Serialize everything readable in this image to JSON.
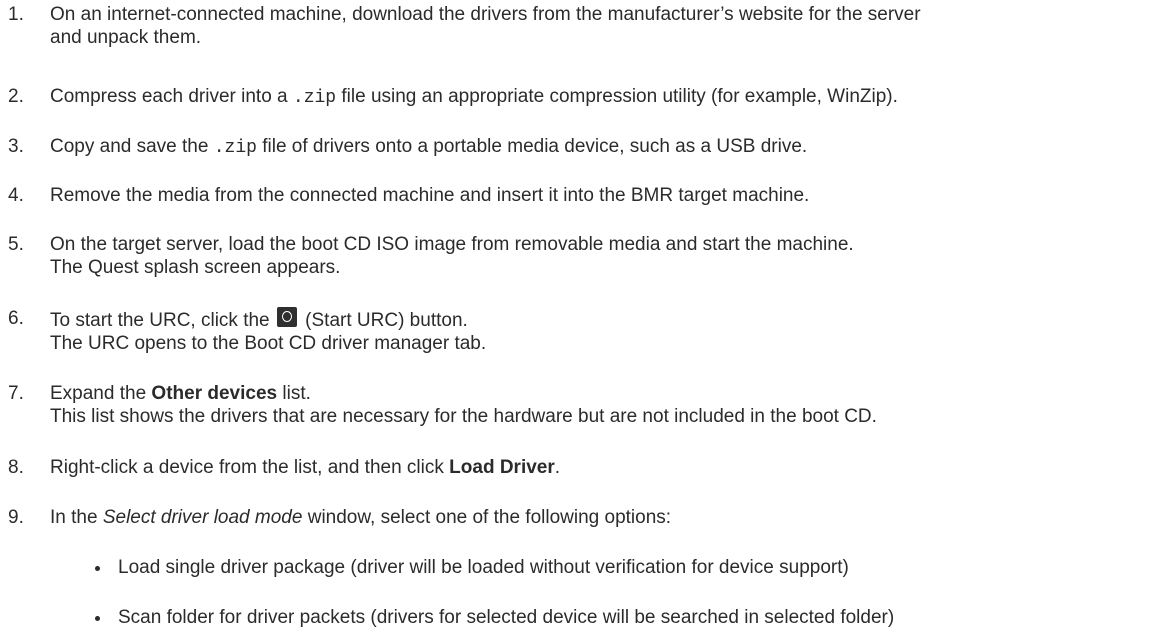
{
  "steps": [
    {
      "num": "1.",
      "l1": "On an internet-connected machine, download the drivers from the manufacturer’s website for the server",
      "l2": "and unpack them."
    },
    {
      "num": "2.",
      "pre": "Compress each driver into a ",
      "code": ".zip",
      "post": " file using an appropriate compression utility (for example, WinZip)."
    },
    {
      "num": "3.",
      "pre": "Copy and save the ",
      "code": ".zip",
      "post": " file of drivers onto a portable media device, such as a USB drive."
    },
    {
      "num": "4.",
      "l1": "Remove the media from the connected machine and insert it into the BMR target machine."
    },
    {
      "num": "5.",
      "l1": "On the target server, load the boot CD ISO image from removable media and start the machine.",
      "l2": "The Quest splash screen appears."
    },
    {
      "num": "6.",
      "pre": "To start the URC, click the ",
      "icon": "start-urc-icon",
      "post": " (Start URC) button.",
      "l2": "The URC opens to the Boot CD driver manager tab."
    },
    {
      "num": "7.",
      "pre": "Expand the ",
      "bold": "Other devices",
      "post": " list.",
      "l2": "This list shows the drivers that are necessary for the hardware but are not included in the boot CD."
    },
    {
      "num": "8.",
      "pre": "Right-click a device from the list, and then click ",
      "bold": "Load Driver",
      "post": "."
    },
    {
      "num": "9.",
      "pre": "In the ",
      "italic": "Select driver load mode",
      "post": " window, select one of the following options:"
    }
  ],
  "options": [
    "Load single driver package (driver will be loaded without verification for device support)",
    "Scan folder for driver packets (drivers for selected device will be searched in selected folder)"
  ]
}
